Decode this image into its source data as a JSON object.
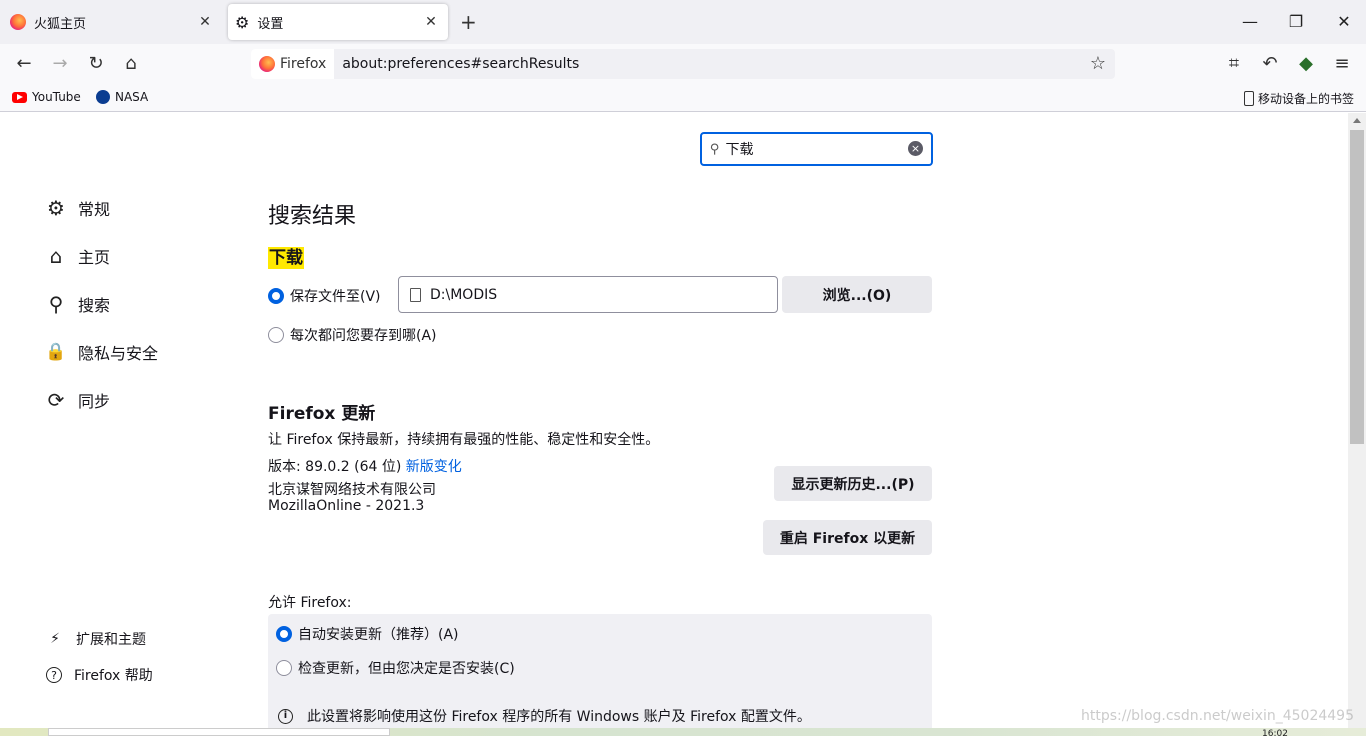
{
  "tabs": [
    {
      "title": "火狐主页",
      "close": "✕"
    },
    {
      "title": "设置",
      "close": "✕"
    }
  ],
  "new_tab": "+",
  "window_controls": {
    "minimize": "—",
    "restore": "❐",
    "close": "✕"
  },
  "nav": {
    "back": "←",
    "forward": "→",
    "reload": "↻",
    "home": "⌂"
  },
  "urlbar": {
    "identity": "Firefox",
    "url": "about:preferences#searchResults",
    "star": "☆"
  },
  "toolbar_icons": [
    "crop-icon",
    "undo-icon",
    "extension-icon",
    "menu-icon"
  ],
  "toolbar_glyphs": {
    "crop": "⌗",
    "undo": "↶",
    "ext": "◆",
    "menu": "≡"
  },
  "bookmarks": [
    {
      "label": "YouTube"
    },
    {
      "label": "NASA"
    }
  ],
  "mobile_bookmarks": "移动设备上的书签",
  "search": {
    "value": "下载",
    "clear": "×",
    "icon": "⚲"
  },
  "sidebar": {
    "items": [
      {
        "label": "常规",
        "icon": "⚙"
      },
      {
        "label": "主页",
        "icon": "⌂"
      },
      {
        "label": "搜索",
        "icon": "⚲"
      },
      {
        "label": "隐私与安全",
        "icon": "🔒"
      },
      {
        "label": "同步",
        "icon": "⟳"
      }
    ],
    "footer": [
      {
        "label": "扩展和主题",
        "icon": "⚡"
      },
      {
        "label": "Firefox 帮助",
        "icon": "?"
      }
    ]
  },
  "main": {
    "title": "搜索结果",
    "downloads": {
      "heading": "下载",
      "save_to_label": "保存文件至(V)",
      "save_to_selected": true,
      "path": "D:\\MODIS",
      "browse_button": "浏览...(O)",
      "always_ask_label": "每次都问您要存到哪(A)"
    },
    "update": {
      "heading": "Firefox 更新",
      "description": "让 Firefox 保持最新，持续拥有最强的性能、稳定性和安全性。",
      "version": "版本: 89.0.2 (64 位)",
      "release_notes": "新版变化",
      "company": "北京谋智网络技术有限公司",
      "edition": "MozillaOnline - 2021.3",
      "history_button": "显示更新历史...(P)",
      "restart_button": "重启 Firefox 以更新",
      "allow_label": "允许 Firefox:",
      "auto_install": "自动安装更新（推荐）(A)",
      "check_only": "检查更新，但由您决定是否安装(C)",
      "info": "此设置将影响使用这份 Firefox 程序的所有 Windows 账户及 Firefox 配置文件。"
    }
  },
  "watermark": "https://blog.csdn.net/weixin_45024495",
  "clock": "16:02",
  "colors": {
    "accent": "#0061e0",
    "highlight": "#ffe900"
  }
}
